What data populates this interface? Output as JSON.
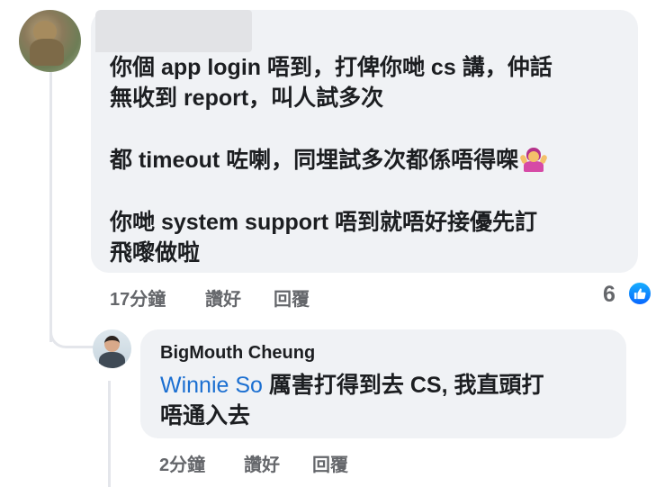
{
  "comment": {
    "paragraphs": [
      "你個 app login 唔到，打俾你哋 cs 講，仲話\n無收到 report，叫人試多次",
      "都 timeout 咗喇，同埋試多次都係唔得㗎",
      "你哋 system support 唔到就唔好接優先訂\n飛嚟做啦"
    ],
    "emoji": "person-shrugging",
    "time": "17分鐘",
    "like_label": "讚好",
    "reply_label": "回覆",
    "reaction_count": "6",
    "reaction_icon": "like-icon"
  },
  "reply": {
    "author": "BigMouth Cheung",
    "mention": "Winnie So",
    "text": " 厲害打得到去 CS, 我直頭打\n唔通入去",
    "time": "2分鐘",
    "like_label": "讚好",
    "reply_label": "回覆"
  },
  "colors": {
    "bubble": "#f0f2f5",
    "mention": "#1b6fd1",
    "like_blue": "#0866ff",
    "meta_gray": "#65676b"
  }
}
